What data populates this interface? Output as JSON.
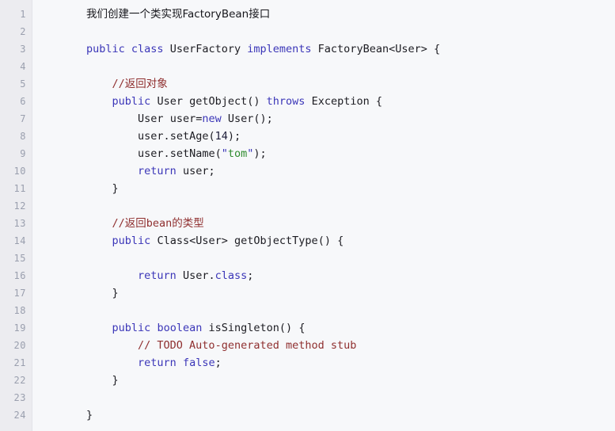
{
  "editor": {
    "language": "java",
    "first_line_number": 1,
    "last_line_number": 24,
    "gutter_background": "#ececf0",
    "code_background": "#f7f8fa",
    "colors": {
      "keyword": "#3b36b8",
      "comment": "#8f2f2f",
      "string": "#2e8b2e",
      "plain": "#1c1c22",
      "line_number": "#9a9fae"
    }
  },
  "line_numbers": [
    "1",
    "2",
    "3",
    "4",
    "5",
    "6",
    "7",
    "8",
    "9",
    "10",
    "11",
    "12",
    "13",
    "14",
    "15",
    "16",
    "17",
    "18",
    "19",
    "20",
    "21",
    "22",
    "23",
    "24"
  ],
  "lines": [
    {
      "n": "1",
      "indent": 0,
      "kind": "prose",
      "text": "我们创建一个类实现FactoryBean接口"
    },
    {
      "n": "2",
      "indent": 0,
      "kind": "blank",
      "text": ""
    },
    {
      "n": "3",
      "indent": 0,
      "kind": "code",
      "text": "public class UserFactory implements FactoryBean<User> {"
    },
    {
      "n": "4",
      "indent": 0,
      "kind": "blank",
      "text": ""
    },
    {
      "n": "5",
      "indent": 1,
      "kind": "comment",
      "text": "//返回对象"
    },
    {
      "n": "6",
      "indent": 1,
      "kind": "code",
      "text": "public User getObject() throws Exception {"
    },
    {
      "n": "7",
      "indent": 2,
      "kind": "code",
      "text": "User user=new User();"
    },
    {
      "n": "8",
      "indent": 2,
      "kind": "code",
      "text": "user.setAge(14);"
    },
    {
      "n": "9",
      "indent": 2,
      "kind": "code",
      "text": "user.setName(\"tom\");"
    },
    {
      "n": "10",
      "indent": 2,
      "kind": "code",
      "text": "return user;"
    },
    {
      "n": "11",
      "indent": 1,
      "kind": "code",
      "text": "}"
    },
    {
      "n": "12",
      "indent": 0,
      "kind": "blank",
      "text": ""
    },
    {
      "n": "13",
      "indent": 1,
      "kind": "comment",
      "text": "//返回bean的类型"
    },
    {
      "n": "14",
      "indent": 1,
      "kind": "code",
      "text": "public Class<User> getObjectType() {"
    },
    {
      "n": "15",
      "indent": 0,
      "kind": "blank",
      "text": ""
    },
    {
      "n": "16",
      "indent": 2,
      "kind": "code",
      "text": "return User.class;"
    },
    {
      "n": "17",
      "indent": 1,
      "kind": "code",
      "text": "}"
    },
    {
      "n": "18",
      "indent": 0,
      "kind": "blank",
      "text": ""
    },
    {
      "n": "19",
      "indent": 1,
      "kind": "code",
      "text": "public boolean isSingleton() {"
    },
    {
      "n": "20",
      "indent": 2,
      "kind": "comment",
      "text": "// TODO Auto-generated method stub"
    },
    {
      "n": "21",
      "indent": 2,
      "kind": "code",
      "text": "return false;"
    },
    {
      "n": "22",
      "indent": 1,
      "kind": "code",
      "text": "}"
    },
    {
      "n": "23",
      "indent": 0,
      "kind": "blank",
      "text": ""
    },
    {
      "n": "24",
      "indent": 0,
      "kind": "code",
      "text": "}"
    }
  ],
  "tokens": {
    "keywords": [
      "public",
      "class",
      "implements",
      "new",
      "return",
      "boolean",
      "false",
      "throws"
    ],
    "types": [
      "UserFactory",
      "FactoryBean",
      "User",
      "Exception",
      "Class"
    ],
    "string_literals": [
      "tom"
    ],
    "numeric_literals": [
      "14"
    ],
    "method_names": [
      "getObject",
      "setAge",
      "setName",
      "getObjectType",
      "isSingleton"
    ]
  }
}
